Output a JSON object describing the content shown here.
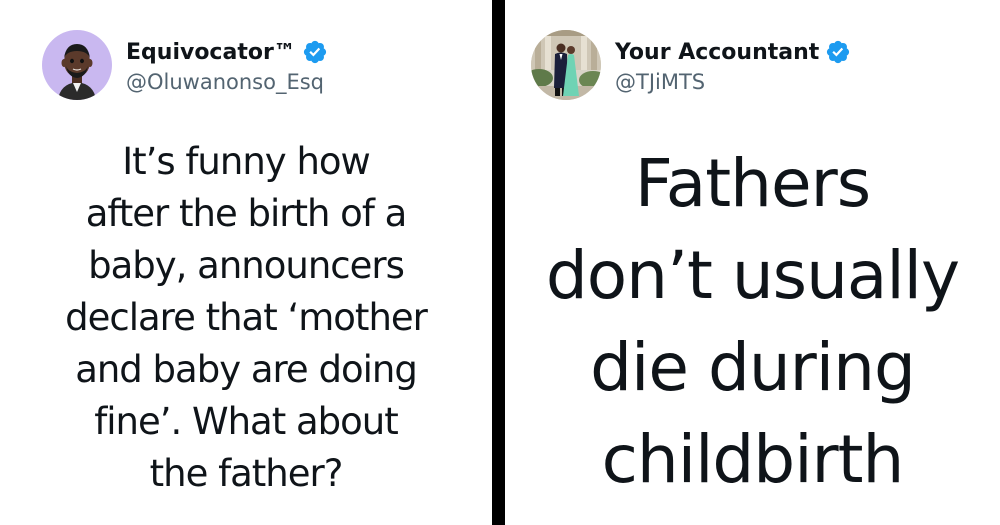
{
  "left_tweet": {
    "display_name": "Equivocator™",
    "handle": "@Oluwanonso_Esq",
    "verified_icon": "verified-badge-icon",
    "lines": [
      "It’s funny how",
      "after the birth of a",
      "baby, announcers",
      "declare that ‘mother",
      "and baby are doing",
      "fine’. What about",
      "the father?"
    ]
  },
  "right_tweet": {
    "display_name": "Your Accountant",
    "handle": "@TJiMTS",
    "verified_icon": "verified-badge-icon",
    "lines": [
      "Fathers",
      "don’t usually",
      "die during",
      "childbirth"
    ]
  },
  "colors": {
    "verified_blue": "#1d9bf0",
    "text": "#0f1419",
    "handle": "#536471",
    "divider": "#000000",
    "avatar_left_bg": "#c9b8f0"
  }
}
